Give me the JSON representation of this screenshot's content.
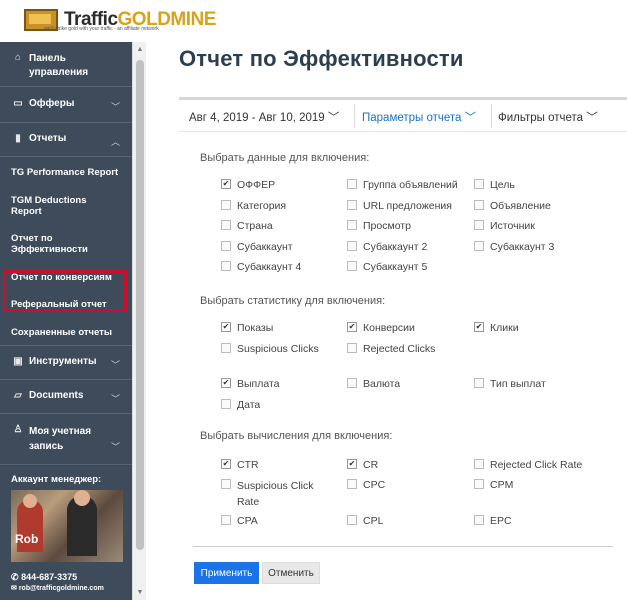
{
  "brand": {
    "name_dark": "Traffic",
    "name_gold": "GOLDMINE",
    "tagline": "we'll strike gold with your traffic · an affiliate network"
  },
  "sidebar": {
    "items": [
      {
        "icon": "home-icon",
        "label": "Панель управления"
      },
      {
        "icon": "chat-icon",
        "label": "Офферы"
      },
      {
        "icon": "bar-chart-icon",
        "label": "Отчеты"
      }
    ],
    "subitems": [
      {
        "label": "TG Performance Report"
      },
      {
        "label": "TGM Deductions Report"
      },
      {
        "label": "Отчет по Эффективности"
      },
      {
        "label": "Отчет по конверсиям"
      },
      {
        "label": "Реферальный отчет"
      },
      {
        "label": "Сохраненные отчеты"
      }
    ],
    "items2": [
      {
        "icon": "briefcase-icon",
        "label": "Инструменты"
      },
      {
        "icon": "folder-icon",
        "label": "Documents"
      },
      {
        "icon": "user-icon",
        "label": "Моя учетная запись"
      }
    ],
    "manager_label": "Аккаунт менеджер:",
    "manager_name": "Rob",
    "phone": "844-687-3375",
    "email": "rob@trafficgoldmine.com"
  },
  "main": {
    "title": "Отчет по Эффективности",
    "date_range": "Авг 4, 2019 - Авг 10, 2019",
    "params_label": "Параметры отчета",
    "filters_label": "Фильтры отчета"
  },
  "sections": {
    "data_title": "Выбрать данные для включения:",
    "stats_title": "Выбрать статистику для включения:",
    "calc_title": "Выбрать вычисления для включения:"
  },
  "data_options": [
    {
      "label": "ОФФЕР",
      "checked": true
    },
    {
      "label": "Группа объявлений",
      "checked": false
    },
    {
      "label": "Цель",
      "checked": false
    },
    {
      "label": "Категория",
      "checked": false
    },
    {
      "label": "URL предложения",
      "checked": false
    },
    {
      "label": "Объявление",
      "checked": false
    },
    {
      "label": "Страна",
      "checked": false
    },
    {
      "label": "Просмотр",
      "checked": false
    },
    {
      "label": "Источник",
      "checked": false
    },
    {
      "label": "Субаккаунт",
      "checked": false
    },
    {
      "label": "Субаккаунт 2",
      "checked": false
    },
    {
      "label": "Субаккаунт 3",
      "checked": false
    },
    {
      "label": "Субаккаунт 4",
      "checked": false
    },
    {
      "label": "Субаккаунт 5",
      "checked": false
    }
  ],
  "stats_options": [
    {
      "label": "Показы",
      "checked": true
    },
    {
      "label": "Конверсии",
      "checked": true
    },
    {
      "label": "Клики",
      "checked": true
    },
    {
      "label": "Suspicious Clicks",
      "checked": false
    },
    {
      "label": "Rejected Clicks",
      "checked": false
    },
    {
      "label": "Выплата",
      "checked": true
    },
    {
      "label": "Валюта",
      "checked": false
    },
    {
      "label": "Тип выплат",
      "checked": false
    },
    {
      "label": "Дата",
      "checked": false
    }
  ],
  "calc_options": [
    {
      "label": "CTR",
      "checked": true
    },
    {
      "label": "CR",
      "checked": true
    },
    {
      "label": "Rejected Click Rate",
      "checked": false
    },
    {
      "label": "Suspicious Click Rate",
      "checked": false
    },
    {
      "label": "CPC",
      "checked": false
    },
    {
      "label": "CPM",
      "checked": false
    },
    {
      "label": "CPA",
      "checked": false
    },
    {
      "label": "CPL",
      "checked": false
    },
    {
      "label": "EPC",
      "checked": false
    }
  ],
  "buttons": {
    "apply": "Применить",
    "cancel": "Отменить"
  },
  "colors": {
    "sidebar": "#3d4b5a",
    "accent": "#1a73e8",
    "active_border": "#c8102e"
  }
}
